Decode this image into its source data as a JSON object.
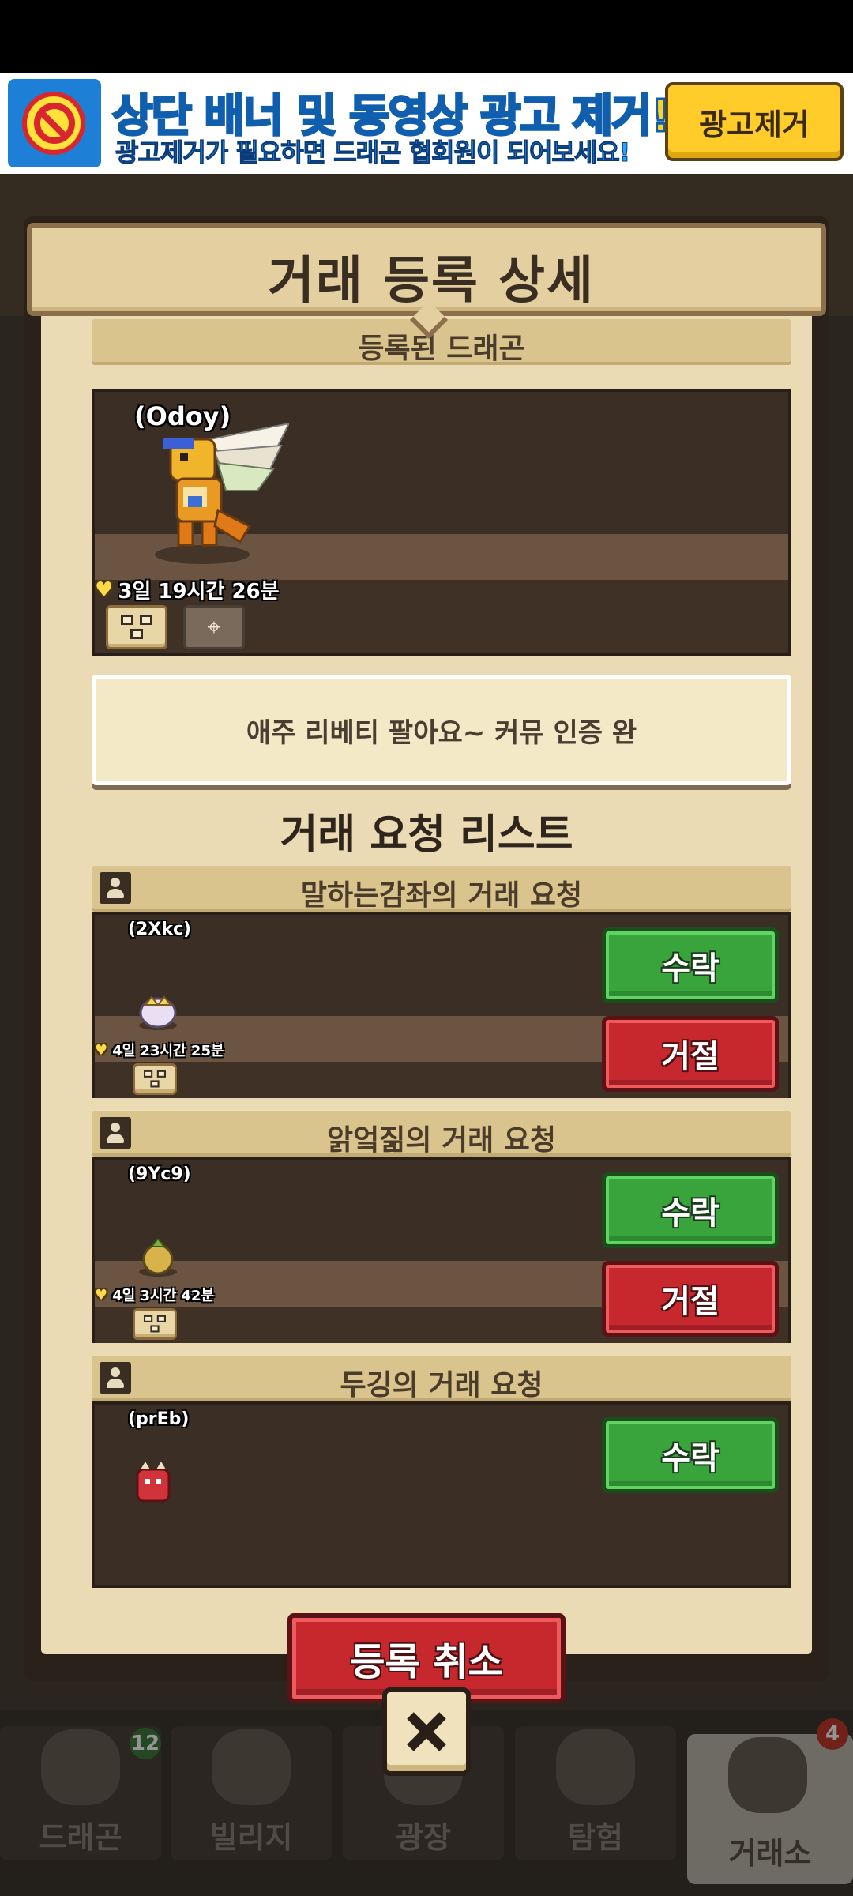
{
  "ad": {
    "title": "상단 배너 및 동영상 광고 제거!",
    "subtitle": "광고제거가 필요하면 드래곤 협회원이 되어보세요!",
    "button_label": "광고제거"
  },
  "modal": {
    "title": "거래 등록 상세",
    "registered_section_title": "등록된 드래곤",
    "registered_dragon": {
      "code": "(Odoy)",
      "time_left": "3일 19시간 26분"
    },
    "memo": "애주 리베티 팔아요~ 커뮤 인증 완",
    "request_list_title": "거래 요청 리스트",
    "requests": [
      {
        "title": "말하는감좌의 거래 요청",
        "code": "(2Xkc)",
        "time_left": "4일 23시간 25분",
        "accept_label": "수락",
        "reject_label": "거절"
      },
      {
        "title": "앍엌짊의 거래 요청",
        "code": "(9Yc9)",
        "time_left": "4일 3시간 42분",
        "accept_label": "수락",
        "reject_label": "거절"
      },
      {
        "title": "두깅의 거래 요청",
        "code": "(prEb)",
        "accept_label": "수락"
      }
    ],
    "cancel_label": "등록 취소"
  },
  "bottom_nav": {
    "items": [
      {
        "label": "드래곤",
        "badge": "12"
      },
      {
        "label": "빌리지"
      },
      {
        "label": "광장"
      },
      {
        "label": "탐험"
      },
      {
        "label": "거래소",
        "badge": "4"
      }
    ]
  },
  "colors": {
    "accept_green": "#3aa43c",
    "reject_red": "#c7282e",
    "parchment": "#eadbb4",
    "header_tan": "#e3cf9f"
  }
}
